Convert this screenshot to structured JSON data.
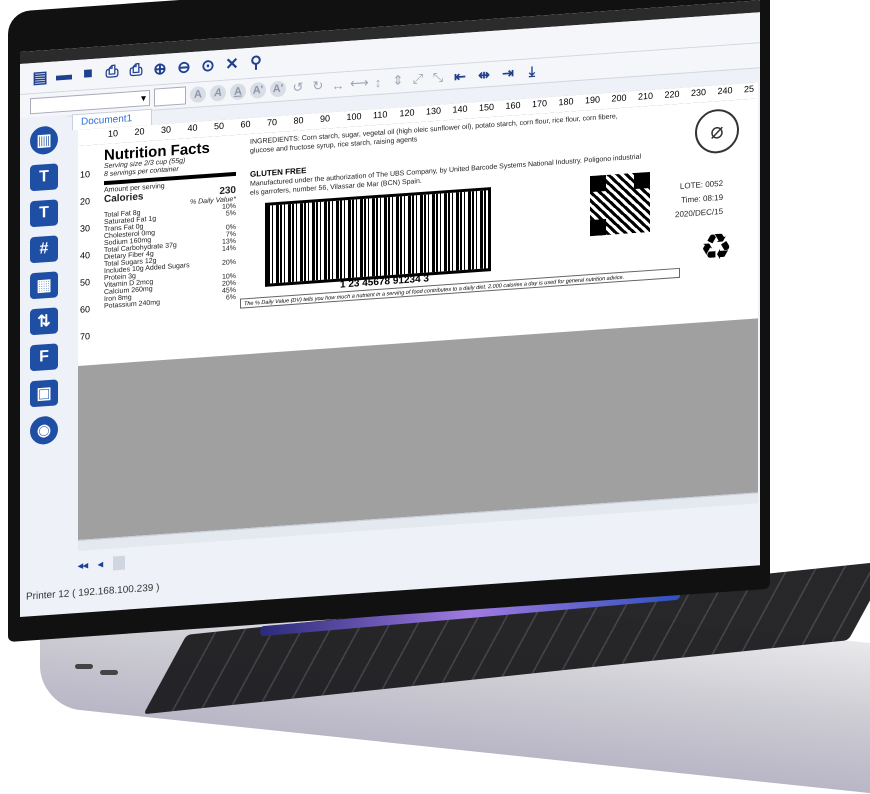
{
  "window": {
    "document_tab": "Document1",
    "status_text": "Printer 12 ( 192.168.100.239 )"
  },
  "toolbar2": {
    "font_select_arrow": "▾",
    "format_buttons": [
      "A",
      "A",
      "A",
      "A'",
      "A'"
    ]
  },
  "label": {
    "nutrition": {
      "title": "Nutrition Facts",
      "serving_size": "Serving size 2/3 cup (55g)",
      "servings": "8 servings per container",
      "amount_per_serving": "Amount per serving",
      "calories_label": "Calories",
      "calories_value": "230",
      "daily_value_header": "% Daily Value*",
      "rows": [
        {
          "name": "Total Fat 8g",
          "dv": "10%"
        },
        {
          "name": "Saturated Fat 1g",
          "dv": "5%"
        },
        {
          "name": "Trans Fat 0g",
          "dv": ""
        },
        {
          "name": "Cholesterol 0mg",
          "dv": "0%"
        },
        {
          "name": "Sodium 160mg",
          "dv": "7%"
        },
        {
          "name": "Total Carbohydrate 37g",
          "dv": "13%"
        },
        {
          "name": "Dietary Fiber 4g",
          "dv": "14%"
        },
        {
          "name": "Total Sugars 12g",
          "dv": ""
        },
        {
          "name": "Includes 10g Added Sugars",
          "dv": "20%"
        },
        {
          "name": "Protein 3g",
          "dv": ""
        },
        {
          "name": "Vitamin D 2mcg",
          "dv": "10%"
        },
        {
          "name": "Calcium 260mg",
          "dv": "20%"
        },
        {
          "name": "Iron 8mg",
          "dv": "45%"
        },
        {
          "name": "Potassium 240mg",
          "dv": "6%"
        }
      ]
    },
    "ingredients": "INGREDIENTS: Corn starch, sugar, vegetal oil (high oleic sunflower oil), potato starch, corn flour, rice flour, corn fibere, glucose and fructose syrup, rice starch, raising agents",
    "gluten_free": "GLUTEN FREE",
    "manufactured": "Manufactured under the authorization of The UBS Company, by United Barcode Systems National Industry. Poligono industrial els garrofers, number 56, Vilassar de Mar (BCN) Spain.",
    "barcode_number": "1 23 45678 91234 3",
    "lote": "LOTE: 0052",
    "time": "Time: 08:19",
    "date": "2020/DEC/15",
    "dv_note": "The % Daily Value (DV) tells you how much a nutrient in a serving of food contributes to a daily diet. 2,000 calories a day is used for general nutrition advice."
  },
  "ruler": {
    "top": [
      "10",
      "20",
      "30",
      "40",
      "50",
      "60",
      "70",
      "80",
      "90",
      "100",
      "110",
      "120",
      "130",
      "140",
      "150",
      "160",
      "170",
      "180",
      "190",
      "200",
      "210",
      "220",
      "230",
      "240",
      "25"
    ],
    "left": [
      "10",
      "20",
      "30",
      "40",
      "50",
      "60",
      "70"
    ]
  },
  "icons": {
    "toolbar1": [
      "new-document-icon",
      "open-folder-icon",
      "save-icon",
      "print-preview-icon",
      "print-icon",
      "zoom-in-icon",
      "zoom-out-icon",
      "zoom-fit-icon",
      "tools-icon",
      "search-settings-icon"
    ],
    "sidebar": [
      "barcode-tool-icon",
      "text-tool-icon",
      "rich-text-tool-icon",
      "counter-tool-icon",
      "date-tool-icon",
      "variable-text-tool-icon",
      "shape-tool-icon",
      "image-tool-icon",
      "database-tool-icon"
    ]
  },
  "nav": {
    "first": "◂◂",
    "prev": "◂"
  }
}
